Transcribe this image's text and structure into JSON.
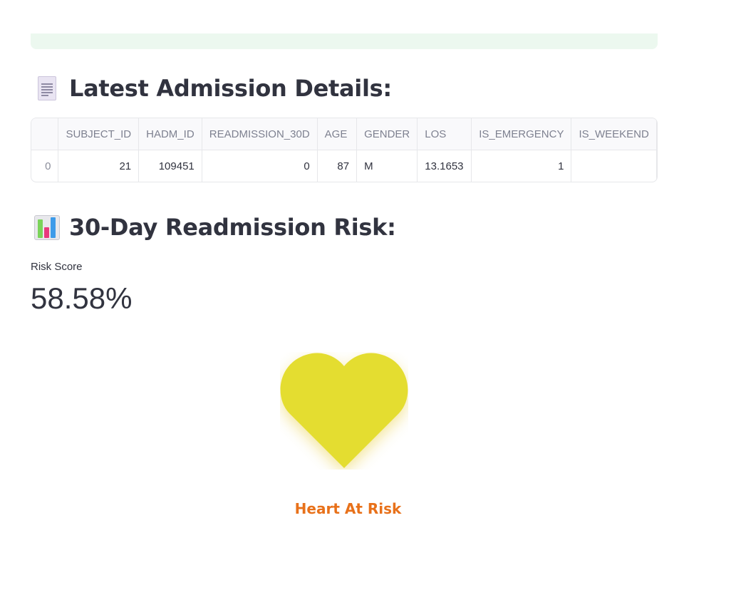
{
  "details_section": {
    "title": "Latest Admission Details:",
    "icon": "page-facing-up-icon"
  },
  "table": {
    "columns": [
      "",
      "SUBJECT_ID",
      "HADM_ID",
      "READMISSION_30D",
      "AGE",
      "GENDER",
      "LOS",
      "IS_EMERGENCY",
      "IS_WEEKEND"
    ],
    "rows": [
      [
        "0",
        "21",
        "109451",
        "0",
        "87",
        "M",
        "13.1653",
        "1",
        ""
      ]
    ]
  },
  "risk_section": {
    "title": "30-Day Readmission Risk:",
    "icon": "bar-chart-icon"
  },
  "metric": {
    "label": "Risk Score",
    "value": "58.58%"
  },
  "heart": {
    "icon": "heart-icon",
    "color": "#e4dd30",
    "label": "Heart At Risk",
    "label_color": "#e8711a"
  },
  "colors": {
    "success_banner": "#ecf8ef",
    "text": "#31333f"
  }
}
